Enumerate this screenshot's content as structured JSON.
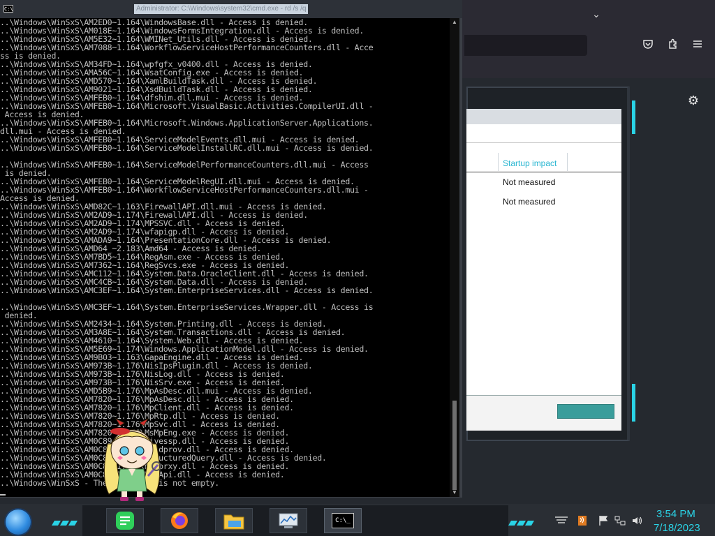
{
  "cmd": {
    "title": "Administrator: C:\\Windows\\system32\\cmd.exe - rd  /s /q",
    "sys_icon_text": "C:\\",
    "lines": [
      "..\\Windows\\WinSxS\\AM2ED0~1.164\\WindowsBase.dll - Access is denied.",
      "..\\Windows\\WinSxS\\AM018E~1.164\\WindowsFormsIntegration.dll - Access is denied.",
      "..\\Windows\\WinSxS\\AM5E32~1.164\\WMINet_Utils.dll - Access is denied.",
      "..\\Windows\\WinSxS\\AM7088~1.164\\WorkflowServiceHostPerformanceCounters.dll - Acce",
      "ss is denied.",
      "..\\Windows\\WinSxS\\AM34FD~1.164\\wpfgfx_v0400.dll - Access is denied.",
      "..\\Windows\\WinSxS\\AMA56C~1.164\\WsatConfig.exe - Access is denied.",
      "..\\Windows\\WinSxS\\AMD570~1.164\\XamlBuildTask.dll - Access is denied.",
      "..\\Windows\\WinSxS\\AM9021~1.164\\XsdBuildTask.dll - Access is denied.",
      "..\\Windows\\WinSxS\\AMFEB0~1.164\\dfshim.dll.mui - Access is denied.",
      "..\\Windows\\WinSxS\\AMFEB0~1.164\\Microsoft.VisualBasic.Activities.CompilerUI.dll -",
      " Access is denied.",
      "..\\Windows\\WinSxS\\AMFEB0~1.164\\Microsoft.Windows.ApplicationServer.Applications.",
      "dll.mui - Access is denied.",
      "..\\Windows\\WinSxS\\AMFEB0~1.164\\ServiceModelEvents.dll.mui - Access is denied.",
      "..\\Windows\\WinSxS\\AMFEB0~1.164\\ServiceModelInstallRC.dll.mui - Access is denied.",
      "",
      "..\\Windows\\WinSxS\\AMFEB0~1.164\\ServiceModelPerformanceCounters.dll.mui - Access",
      " is denied.",
      "..\\Windows\\WinSxS\\AMFEB0~1.164\\ServiceModelRegUI.dll.mui - Access is denied.",
      "..\\Windows\\WinSxS\\AMFEB0~1.164\\WorkflowServiceHostPerformanceCounters.dll.mui -",
      "Access is denied.",
      "..\\Windows\\WinSxS\\AMD82C~1.163\\FirewallAPI.dll.mui - Access is denied.",
      "..\\Windows\\WinSxS\\AM2AD9~1.174\\FirewallAPI.dll - Access is denied.",
      "..\\Windows\\WinSxS\\AM2AD9~1.174\\MPSSVC.dll - Access is denied.",
      "..\\Windows\\WinSxS\\AM2AD9~1.174\\wfapigp.dll - Access is denied.",
      "..\\Windows\\WinSxS\\AMADA9~1.164\\PresentationCore.dll - Access is denied.",
      "..\\Windows\\WinSxS\\AMD64_~2.183\\Amd64 - Access is denied.",
      "..\\Windows\\WinSxS\\AM7BD5~1.164\\RegAsm.exe - Access is denied.",
      "..\\Windows\\WinSxS\\AM7362~1.164\\RegSvcs.exe - Access is denied.",
      "..\\Windows\\WinSxS\\AMC112~1.164\\System.Data.OracleClient.dll - Access is denied.",
      "..\\Windows\\WinSxS\\AMC4CB~1.164\\System.Data.dll - Access is denied.",
      "..\\Windows\\WinSxS\\AMC3EF~1.164\\System.EnterpriseServices.dll - Access is denied.",
      "",
      "..\\Windows\\WinSxS\\AMC3EF~1.164\\System.EnterpriseServices.Wrapper.dll - Access is",
      " denied.",
      "..\\Windows\\WinSxS\\AM2434~1.164\\System.Printing.dll - Access is denied.",
      "..\\Windows\\WinSxS\\AM3A8E~1.164\\System.Transactions.dll - Access is denied.",
      "..\\Windows\\WinSxS\\AM4610~1.164\\System.Web.dll - Access is denied.",
      "..\\Windows\\WinSxS\\AM5E69~1.174\\Windows.ApplicationModel.dll - Access is denied.",
      "..\\Windows\\WinSxS\\AM9B03~1.163\\GapaEngine.dll - Access is denied.",
      "..\\Windows\\WinSxS\\AM973B~1.176\\NisIpsPlugin.dll - Access is denied.",
      "..\\Windows\\WinSxS\\AM973B~1.176\\NisLog.dll - Access is denied.",
      "..\\Windows\\WinSxS\\AM973B~1.176\\NisSrv.exe - Access is denied.",
      "..\\Windows\\WinSxS\\AMD5B9~1.176\\MpAsDesc.dll.mui - Access is denied.",
      "..\\Windows\\WinSxS\\AM7820~1.176\\MpAsDesc.dll - Access is denied.",
      "..\\Windows\\WinSxS\\AM7820~1.176\\MpClient.dll - Access is denied.",
      "..\\Windows\\WinSxS\\AM7820~1.176\\MpRtp.dll - Access is denied.",
      "..\\Windows\\WinSxS\\AM7820~1.176\\MpSvc.dll - Access is denied.",
      "..\\Windows\\WinSxS\\AM7820~1.176\\MsMpEng.exe - Access is denied.",
      "..\\Windows\\WinSxS\\AM0C89~1.174\\livessp.dll - Access is denied.",
      "..\\Windows\\WinSxS\\AM0C89~1.174\\wlidprov.dll - Access is denied.",
      "..\\Windows\\WinSxS\\AM0C89~1.174\\StructuredQuery.dll - Access is denied.",
      "..\\Windows\\WinSxS\\AM0C89~1.177\\mssprxy.dll - Access is denied.",
      "..\\Windows\\WinSxS\\AM0C89~1.174\\WSDApi.dll - Access is denied.",
      "..\\Windows\\WinSxS - The directory is not empty."
    ]
  },
  "task_manager": {
    "column_header": "Startup impact",
    "rows": [
      "Not measured",
      "Not measured"
    ]
  },
  "browser_icons": [
    "chevron-down-icon",
    "pocket-icon",
    "extensions-icon",
    "menu-icon",
    "settings-icon"
  ],
  "taskbar": {
    "apps": [
      "notepad-icon",
      "firefox-icon",
      "file-explorer-icon",
      "task-manager-icon",
      "cmd-icon"
    ],
    "cmd_glyph": "C:\\_"
  },
  "tray": {
    "time": "3:54 PM",
    "date": "7/18/2023"
  },
  "colors": {
    "accent": "#2ad3e6",
    "console_bg": "#000000",
    "console_text": "#c0c0c0"
  }
}
